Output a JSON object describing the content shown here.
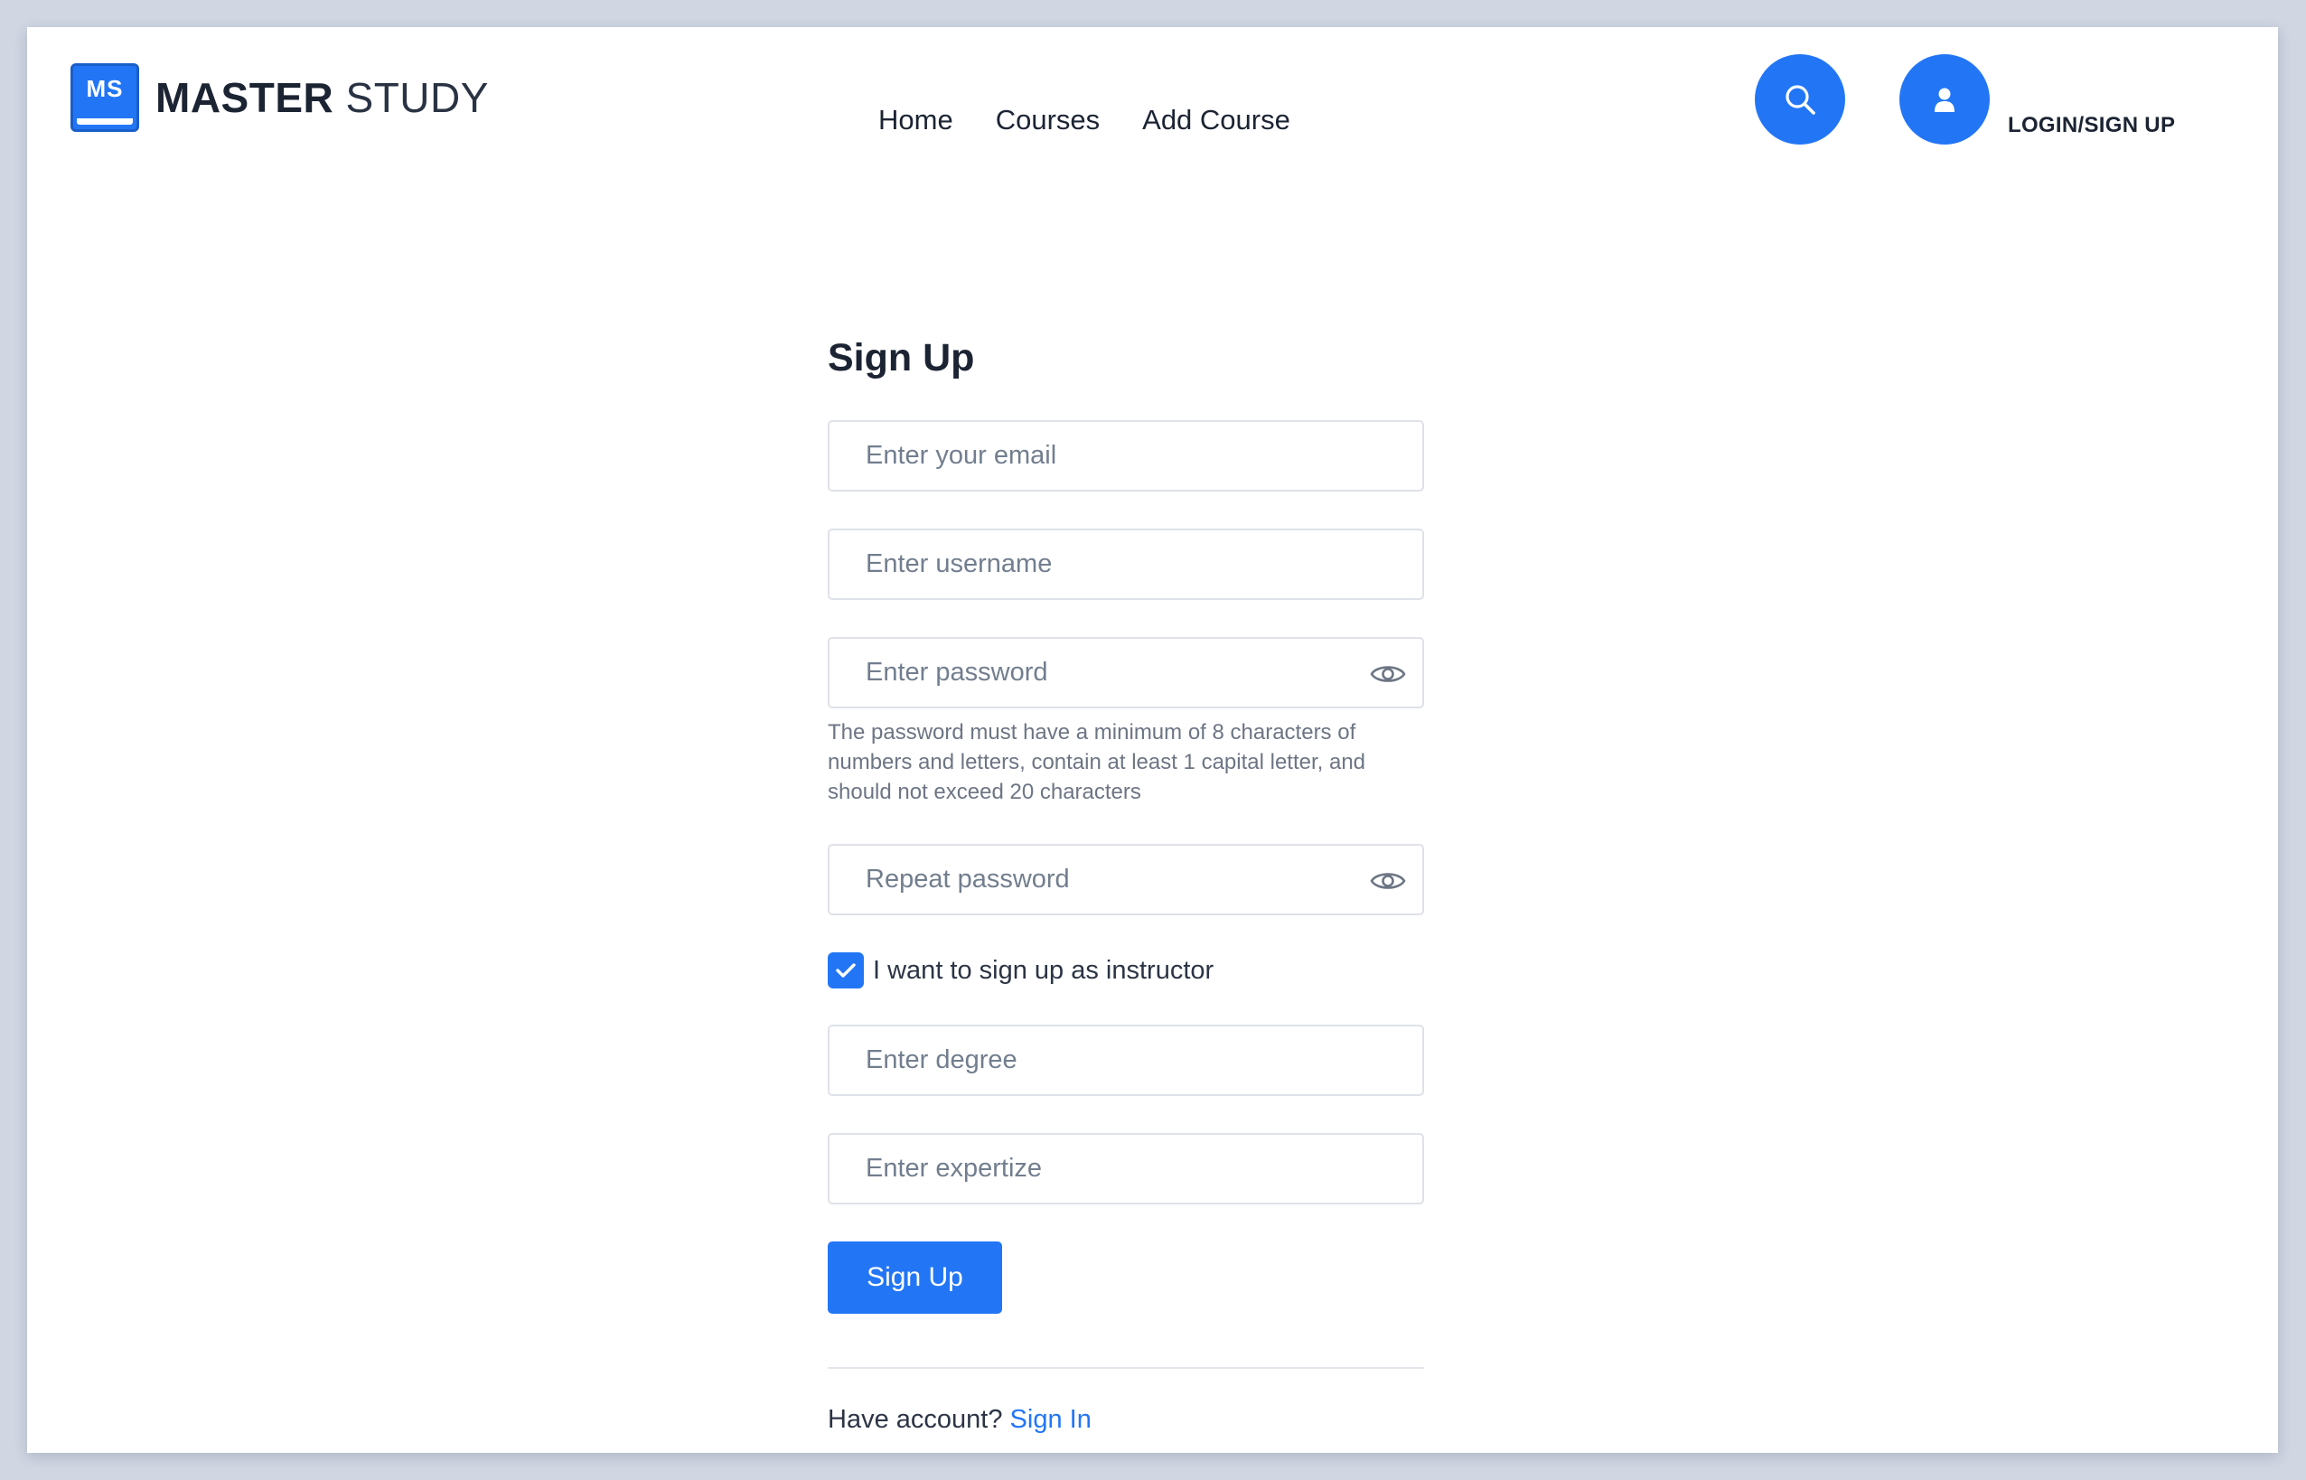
{
  "header": {
    "logo": {
      "badge": "MS",
      "text_bold": "MASTER",
      "text_light": "STUDY"
    },
    "nav": [
      {
        "label": "Home"
      },
      {
        "label": "Courses"
      },
      {
        "label": "Add Course"
      }
    ],
    "search_icon": "search-icon",
    "user_icon": "user-icon",
    "login_label": "LOGIN/SIGN UP"
  },
  "form": {
    "title": "Sign Up",
    "email": {
      "placeholder": "Enter your email",
      "value": ""
    },
    "username": {
      "placeholder": "Enter username",
      "value": ""
    },
    "password": {
      "placeholder": "Enter password",
      "value": "",
      "toggle_icon": "eye-icon"
    },
    "password_hint": "The password must have a minimum of 8 characters of numbers and letters, contain at least 1 capital letter, and should not exceed 20 characters",
    "repeat_password": {
      "placeholder": "Repeat password",
      "value": "",
      "toggle_icon": "eye-icon"
    },
    "instructor_checkbox": {
      "label": "I want to sign up as instructor",
      "checked": true
    },
    "degree": {
      "placeholder": "Enter degree",
      "value": ""
    },
    "expertize": {
      "placeholder": "Enter expertize",
      "value": ""
    },
    "submit_label": "Sign Up",
    "footer": {
      "text": "Have account?",
      "link_label": "Sign In"
    }
  },
  "colors": {
    "accent": "#2276f6",
    "text_dark": "#1c2433",
    "placeholder": "#727e8e",
    "border": "#dfe2e8",
    "backdrop": "#d0d6e2"
  }
}
